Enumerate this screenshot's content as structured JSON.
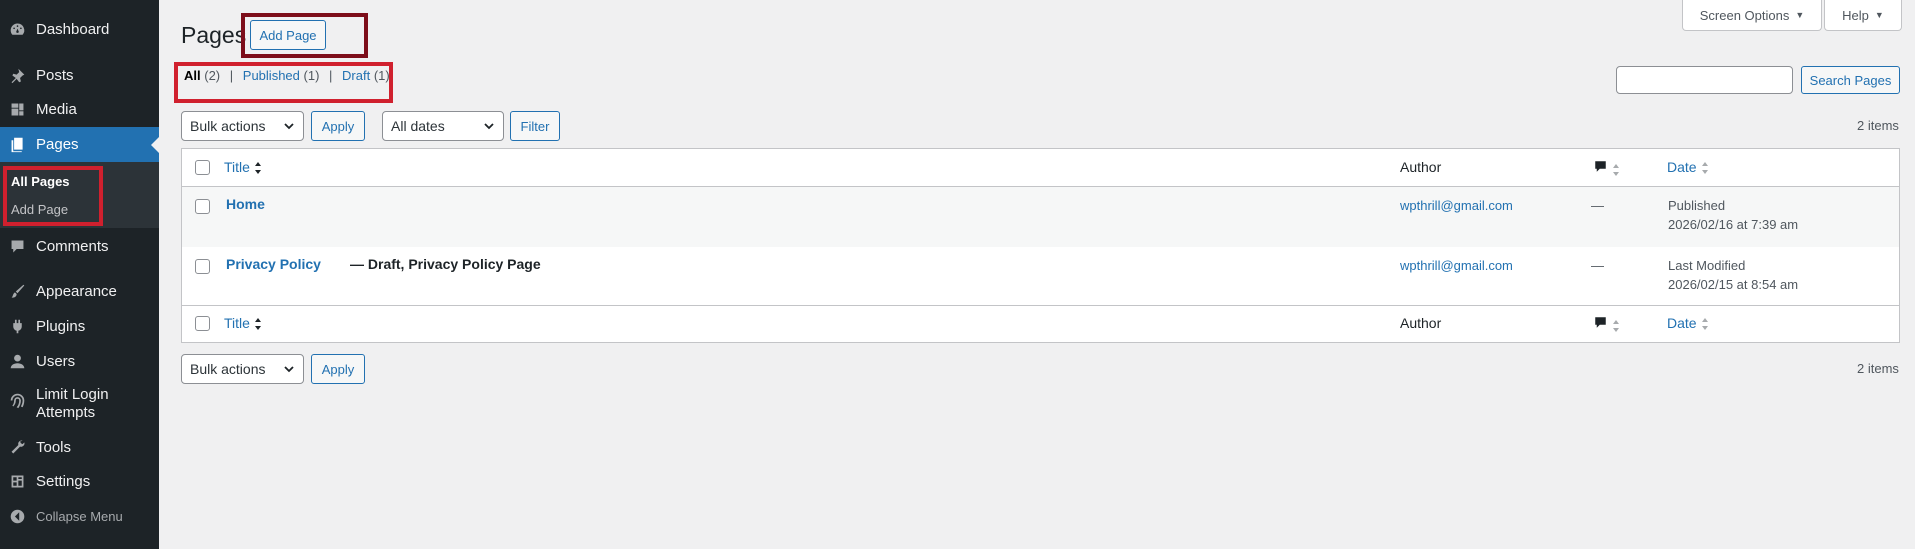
{
  "sidebar": {
    "items": [
      {
        "label": "Dashboard",
        "icon": "dashboard-icon"
      },
      {
        "label": "Posts",
        "icon": "pin-icon"
      },
      {
        "label": "Media",
        "icon": "media-icon"
      },
      {
        "label": "Pages",
        "icon": "pages-icon"
      },
      {
        "label": "Comments",
        "icon": "comment-icon"
      },
      {
        "label": "Appearance",
        "icon": "brush-icon"
      },
      {
        "label": "Plugins",
        "icon": "plugin-icon"
      },
      {
        "label": "Users",
        "icon": "user-icon"
      },
      {
        "label": "Limit Login",
        "label2": "Attempts",
        "icon": "fingerprint-icon"
      },
      {
        "label": "Tools",
        "icon": "wrench-icon"
      },
      {
        "label": "Settings",
        "icon": "settings-icon"
      },
      {
        "label": "Collapse Menu",
        "icon": "collapse-icon"
      }
    ],
    "submenu": [
      {
        "label": "All Pages"
      },
      {
        "label": "Add Page"
      }
    ]
  },
  "header": {
    "title": "Pages",
    "add_page": "Add Page",
    "screen_options": "Screen Options",
    "help": "Help"
  },
  "views": {
    "all": "All",
    "all_count": "(2)",
    "published": "Published",
    "published_count": "(1)",
    "draft": "Draft",
    "draft_count": "(1)",
    "sep": "|"
  },
  "search": {
    "button": "Search Pages",
    "value": ""
  },
  "tablenav": {
    "bulk_actions": "Bulk actions",
    "apply": "Apply",
    "all_dates": "All dates",
    "filter": "Filter",
    "items_count": "2 items"
  },
  "table": {
    "columns": {
      "title": "Title",
      "author": "Author",
      "date": "Date"
    },
    "rows": [
      {
        "title": "Home",
        "state": "",
        "author": "wpthrill@gmail.com",
        "comments": "—",
        "date_status": "Published",
        "date": "2026/02/16 at 7:39 am"
      },
      {
        "title": "Privacy Policy",
        "state": "— Draft, Privacy Policy Page",
        "author": "wpthrill@gmail.com",
        "comments": "—",
        "date_status": "Last Modified",
        "date": "2026/02/15 at 8:54 am"
      }
    ]
  },
  "colors": {
    "sidebar_bg": "#1d2327",
    "accent": "#2271b1",
    "highlight_red": "#d0202e",
    "highlight_dark_red": "#7d0d1a"
  }
}
